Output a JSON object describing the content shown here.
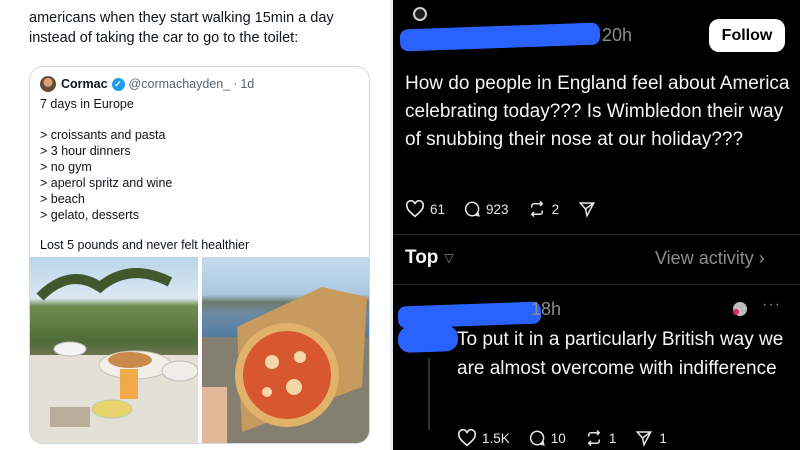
{
  "left": {
    "caption": "americans when they start walking 15min a day instead of taking the car to go to the toilet:",
    "quote": {
      "name": "Cormac",
      "handle": "@cormachayden_",
      "dot": "·",
      "time": "1d",
      "lines": [
        "7 days in Europe",
        "> croissants and pasta",
        "> 3 hour dinners",
        "> no gym",
        "> aperol spritz and wine",
        "> beach",
        "> gelato, desserts",
        "Lost 5 pounds and never felt healthier"
      ]
    }
  },
  "right": {
    "post": {
      "time": "20h",
      "follow_label": "Follow",
      "text": "How do people in England feel about America celebrating today??? Is Wimbledon their way of snubbing their nose at our holiday???",
      "likes": "61",
      "replies": "923",
      "reposts": "2"
    },
    "sort": {
      "label": "Top",
      "view_activity": "View activity"
    },
    "reply": {
      "time": "18h",
      "more": "···",
      "text": "To put it in a particularly British way we are almost overcome with indifference",
      "likes": "1.5K",
      "replies": "10",
      "reposts": "1",
      "shares": "1"
    }
  },
  "colors": {
    "redaction": "#2962ff",
    "dark_bg": "#000000",
    "muted": "#8c8c8c",
    "verified": "#1d9bf0"
  },
  "icons": [
    "verified-badge-icon",
    "heart-icon",
    "comment-icon",
    "repost-icon",
    "send-icon",
    "chevron-down-icon",
    "chevron-right-icon",
    "more-icon"
  ]
}
